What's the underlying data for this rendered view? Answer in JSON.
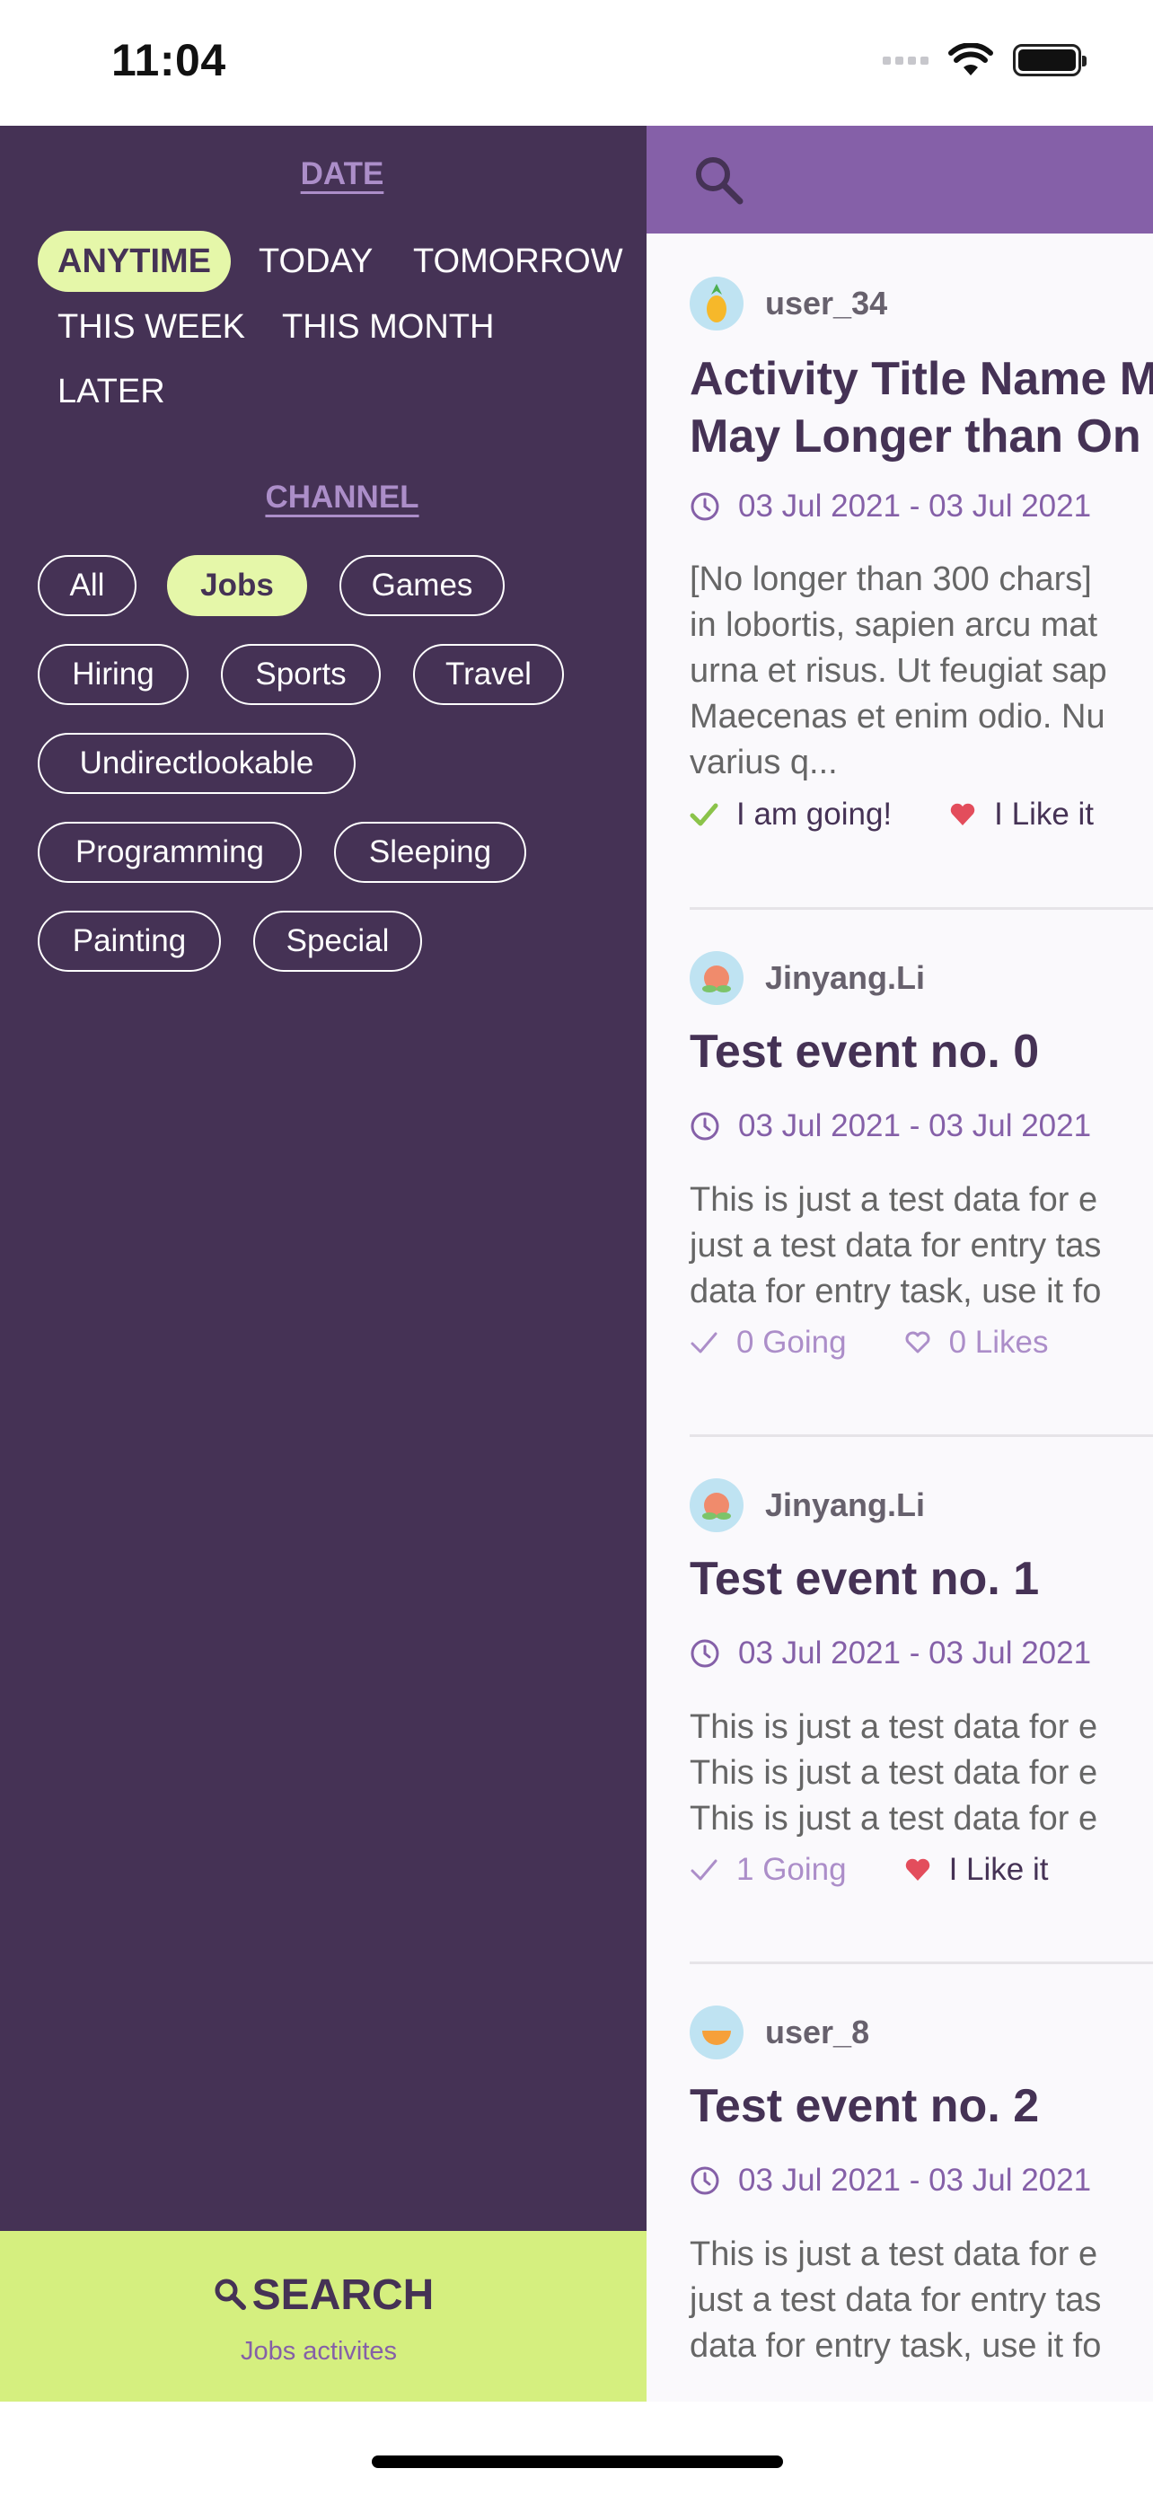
{
  "status_bar": {
    "time": "11:04"
  },
  "drawer": {
    "date_title": "DATE",
    "date_options": [
      "ANYTIME",
      "TODAY",
      "TOMORROW",
      "THIS WEEK",
      "THIS MONTH",
      "LATER"
    ],
    "date_selected": "ANYTIME",
    "channel_title": "CHANNEL",
    "channels": [
      "All",
      "Jobs",
      "Games",
      "Hiring",
      "Sports",
      "Travel",
      "Undirectlookable",
      "Programming",
      "Sleeping",
      "Painting",
      "Special"
    ],
    "channel_selected": "Jobs",
    "search_label": "SEARCH",
    "search_subtitle": "Jobs activites"
  },
  "events": [
    {
      "user": "user_34",
      "avatar": "pineapple-avatar",
      "title_lines": [
        "Activity Title Name M",
        "May Longer than On"
      ],
      "time": "03 Jul 2021 - 03 Jul 2021",
      "desc_lines": [
        "[No longer than 300 chars]",
        "in lobortis, sapien arcu mat",
        "urna et risus. Ut feugiat sap",
        "Maecenas et enim odio. Nu",
        "varius q..."
      ],
      "going_label": "I am going!",
      "like_label": "I Like it",
      "going_active": true,
      "like_active": true
    },
    {
      "user": "Jinyang.Li",
      "avatar": "peach-avatar",
      "title_lines": [
        "Test event no. 0"
      ],
      "time": "03 Jul 2021 - 03 Jul 2021",
      "desc_lines": [
        "This is just a test data for e",
        "just a test data for entry tas",
        "data for entry task, use it fo"
      ],
      "going_label": "0 Going",
      "like_label": "0 Likes",
      "going_active": false,
      "like_active": false
    },
    {
      "user": "Jinyang.Li",
      "avatar": "peach-avatar",
      "title_lines": [
        "Test event no. 1"
      ],
      "time": "03 Jul 2021 - 03 Jul 2021",
      "desc_lines": [
        "This is just a test data for e",
        "This is just a test data for e",
        "This is just a test data for e"
      ],
      "going_label": "1 Going",
      "like_label": "I Like it",
      "going_active": false,
      "like_active": true
    },
    {
      "user": "user_8",
      "avatar": "melon-avatar",
      "title_lines": [
        "Test event no. 2"
      ],
      "time": "03 Jul 2021 - 03 Jul 2021",
      "desc_lines": [
        "This is just a test data for e",
        "just a test data for entry tas",
        "data for entry task, use it fo"
      ]
    }
  ],
  "colors": {
    "drawer_bg": "#453255",
    "accent_purple": "#8560a8",
    "selected_chip": "#e5f7a9",
    "search_bar": "#d5ef7f",
    "going_check": "#8bc34a",
    "like_heart": "#e34d5c"
  }
}
